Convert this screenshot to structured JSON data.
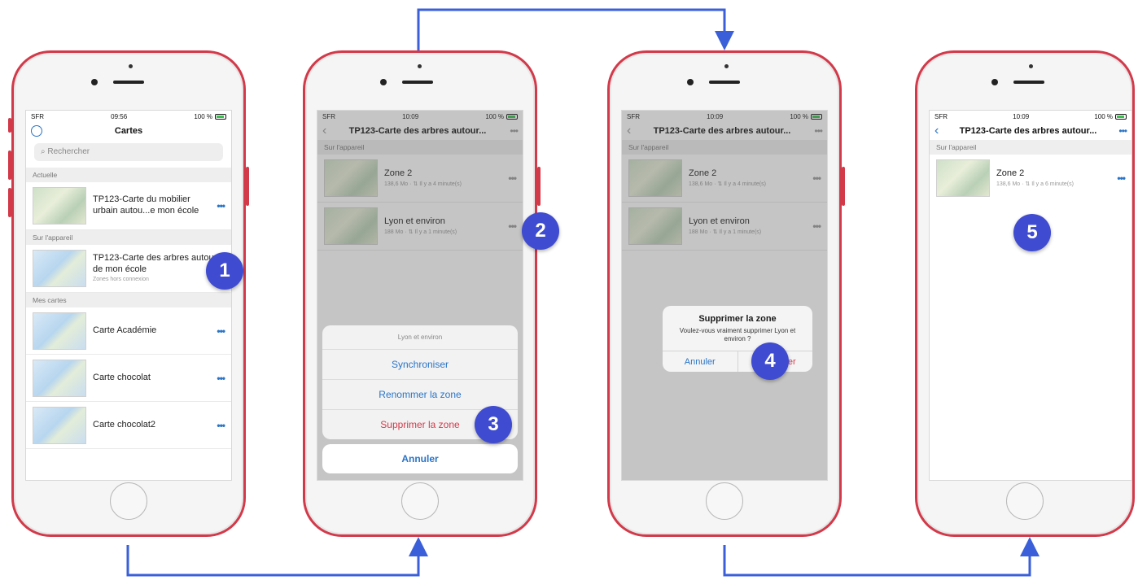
{
  "colors": {
    "phone_frame": "#d23a4a",
    "accent_blue": "#2a74c6",
    "badge": "#3f4bd0",
    "arrow": "#3a5fd9",
    "destructive": "#d23a4a"
  },
  "phone1": {
    "status": {
      "carrier": "SFR",
      "time": "09:56",
      "battery": "100 %"
    },
    "title": "Cartes",
    "search_placeholder": "Rechercher",
    "sections": {
      "current": "Actuelle",
      "device": "Sur l'appareil",
      "mine": "Mes cartes"
    },
    "current_item": {
      "title": "TP123-Carte du mobilier urbain autou...e mon école"
    },
    "device_item": {
      "title": "TP123-Carte des arbres autour de mon école",
      "subtitle": "Zones hors connexion"
    },
    "my_maps": [
      {
        "title": "Carte Académie"
      },
      {
        "title": "Carte chocolat"
      },
      {
        "title": "Carte chocolat2"
      }
    ],
    "badge": "1"
  },
  "phone2": {
    "status": {
      "carrier": "SFR",
      "time": "10:09",
      "battery": "100 %"
    },
    "title": "TP123-Carte des arbres autour...",
    "section": "Sur l'appareil",
    "zones": [
      {
        "name": "Zone 2",
        "meta": "138,6 Mo · ⇅ Il y a 4 minute(s)"
      },
      {
        "name": "Lyon et environ",
        "meta": "188 Mo · ⇅ Il y a 1 minute(s)"
      }
    ],
    "sheet": {
      "title": "Lyon et environ",
      "sync": "Synchroniser",
      "rename": "Renommer la zone",
      "delete": "Supprimer la zone",
      "cancel": "Annuler"
    },
    "badge_a": "2",
    "badge_b": "3"
  },
  "phone3": {
    "status": {
      "carrier": "SFR",
      "time": "10:09",
      "battery": "100 %"
    },
    "title": "TP123-Carte des arbres autour...",
    "section": "Sur l'appareil",
    "zones": [
      {
        "name": "Zone 2",
        "meta": "138,6 Mo · ⇅ Il y a 4 minute(s)"
      },
      {
        "name": "Lyon et environ",
        "meta": "188 Mo · ⇅ Il y a 1 minute(s)"
      }
    ],
    "alert": {
      "title": "Supprimer la zone",
      "message": "Voulez-vous vraiment supprimer Lyon et environ ?",
      "cancel": "Annuler",
      "confirm": "Supprimer"
    },
    "badge": "4"
  },
  "phone4": {
    "status": {
      "carrier": "SFR",
      "time": "10:09",
      "battery": "100 %"
    },
    "title": "TP123-Carte des arbres autour...",
    "section": "Sur l'appareil",
    "zones": [
      {
        "name": "Zone 2",
        "meta": "138,6 Mo · ⇅ Il y a 6 minute(s)"
      }
    ],
    "badge": "5"
  }
}
